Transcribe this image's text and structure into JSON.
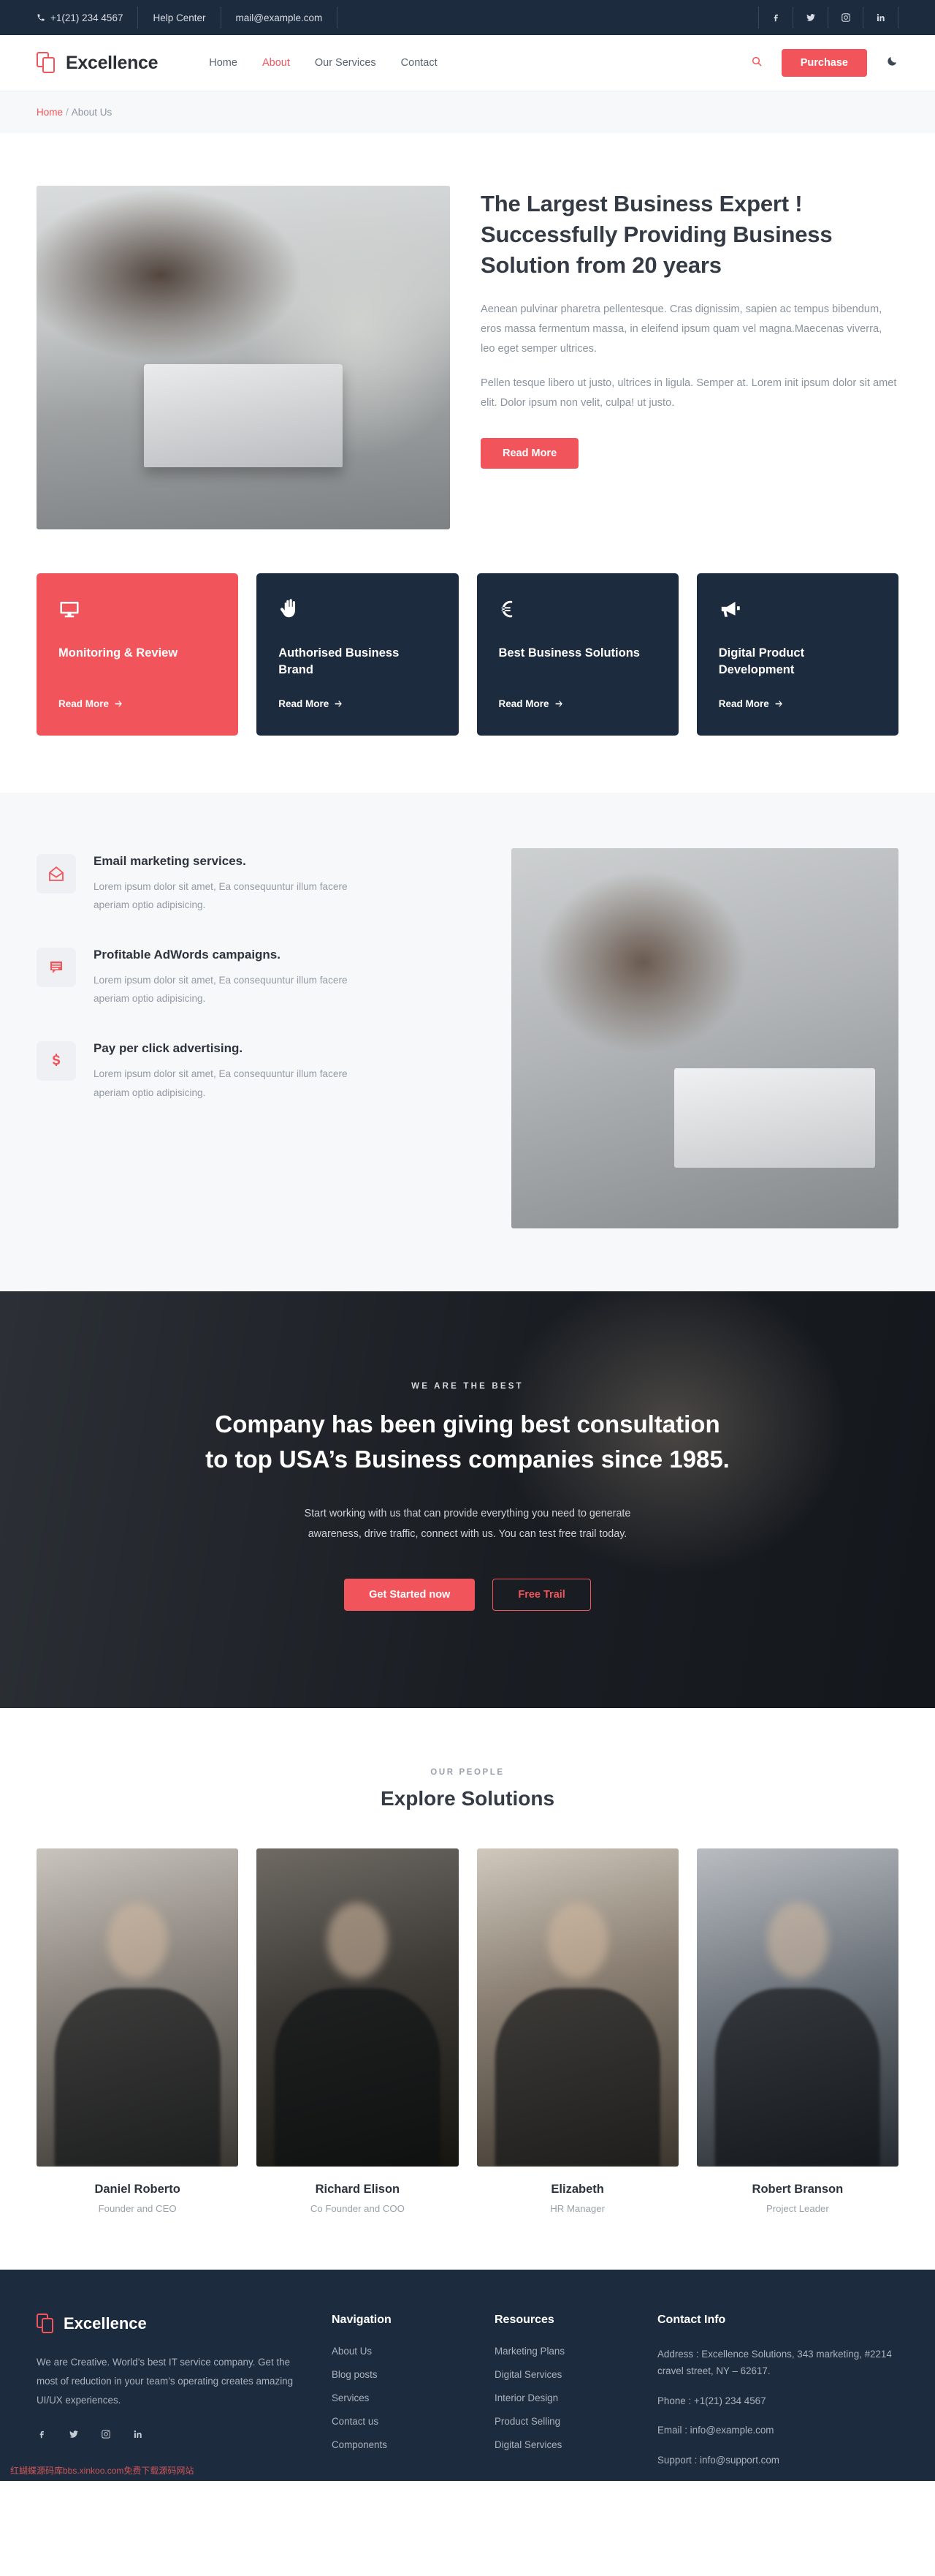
{
  "topbar": {
    "phone": "+1(21) 234 4567",
    "help": "Help Center",
    "email": "mail@example.com",
    "socials": [
      "facebook-icon",
      "twitter-icon",
      "instagram-icon",
      "linkedin-icon"
    ]
  },
  "header": {
    "brand": "Excellence",
    "nav": [
      {
        "label": "Home",
        "active": false
      },
      {
        "label": "About",
        "active": true
      },
      {
        "label": "Our Services",
        "active": false
      },
      {
        "label": "Contact",
        "active": false
      }
    ],
    "purchase_label": "Purchase",
    "accent_color": "#f2545b",
    "dark_color": "#1d2b3e"
  },
  "breadcrumb": {
    "home": "Home",
    "sep": "/",
    "current": "About Us"
  },
  "hero": {
    "title": "The Largest Business Expert ! Successfully Providing Business Solution from 20 years",
    "p1": "Aenean pulvinar pharetra pellentesque. Cras dignissim, sapien ac tempus bibendum, eros massa fermentum massa, in eleifend ipsum quam vel magna.Maecenas viverra, leo eget semper ultrices.",
    "p2": "Pellen tesque libero ut justo, ultrices in ligula. Semper at. Lorem init ipsum dolor sit amet elit. Dolor ipsum non velit, culpa! ut justo.",
    "button": "Read More"
  },
  "cards": [
    {
      "title": "Monitoring & Review",
      "more": "Read More",
      "icon": "monitor-icon",
      "accent": true
    },
    {
      "title": "Authorised Business Brand",
      "more": "Read More",
      "icon": "hand-icon",
      "accent": false
    },
    {
      "title": "Best Business Solutions",
      "more": "Read More",
      "icon": "euro-icon",
      "accent": false
    },
    {
      "title": "Digital Product Development",
      "more": "Read More",
      "icon": "megaphone-icon",
      "accent": false
    }
  ],
  "features": [
    {
      "title": "Email marketing services.",
      "text": "Lorem ipsum dolor sit amet, Ea consequuntur illum facere aperiam optio adipisicing.",
      "icon": "envelope-icon"
    },
    {
      "title": "Profitable AdWords campaigns.",
      "text": "Lorem ipsum dolor sit amet, Ea consequuntur illum facere aperiam optio adipisicing.",
      "icon": "chat-lines-icon"
    },
    {
      "title": "Pay per click advertising.",
      "text": "Lorem ipsum dolor sit amet, Ea consequuntur illum facere aperiam optio adipisicing.",
      "icon": "dollar-icon"
    }
  ],
  "cta": {
    "kicker": "WE ARE THE BEST",
    "heading_l1": "Company has been giving best consultation",
    "heading_l2": "to top USA’s Business companies since 1985.",
    "sub_l1": "Start working with us that can provide everything you need to generate",
    "sub_l2": "awareness, drive traffic, connect with us. You can test free trail today.",
    "primary": "Get Started now",
    "secondary": "Free Trail"
  },
  "team": {
    "kicker": "OUR PEOPLE",
    "title": "Explore Solutions",
    "members": [
      {
        "name": "Daniel Roberto",
        "role": "Founder and CEO"
      },
      {
        "name": "Richard Elison",
        "role": "Co Founder and COO"
      },
      {
        "name": "Elizabeth",
        "role": "HR Manager"
      },
      {
        "name": "Robert Branson",
        "role": "Project Leader"
      }
    ]
  },
  "footer": {
    "brand": "Excellence",
    "about": "We are Creative. World’s best IT service company. Get the most of reduction in your team’s operating creates amazing UI/UX experiences.",
    "socials": [
      "facebook-icon",
      "twitter-icon",
      "instagram-icon",
      "linkedin-icon"
    ],
    "nav_title": "Navigation",
    "nav_items": [
      "About Us",
      "Blog posts",
      "Services",
      "Contact us",
      "Components"
    ],
    "res_title": "Resources",
    "res_items": [
      "Marketing Plans",
      "Digital Services",
      "Interior Design",
      "Product Selling",
      "Digital Services"
    ],
    "contact_title": "Contact Info",
    "address": "Address : Excellence Solutions, 343 marketing, #2214 cravel street, NY – 62617.",
    "phone": "Phone : +1(21) 234 4567",
    "email": "Email : info@example.com",
    "support": "Support : info@support.com",
    "watermark": "红蝴蝶源码库bbs.xinkoo.com免费下载源码网站"
  }
}
